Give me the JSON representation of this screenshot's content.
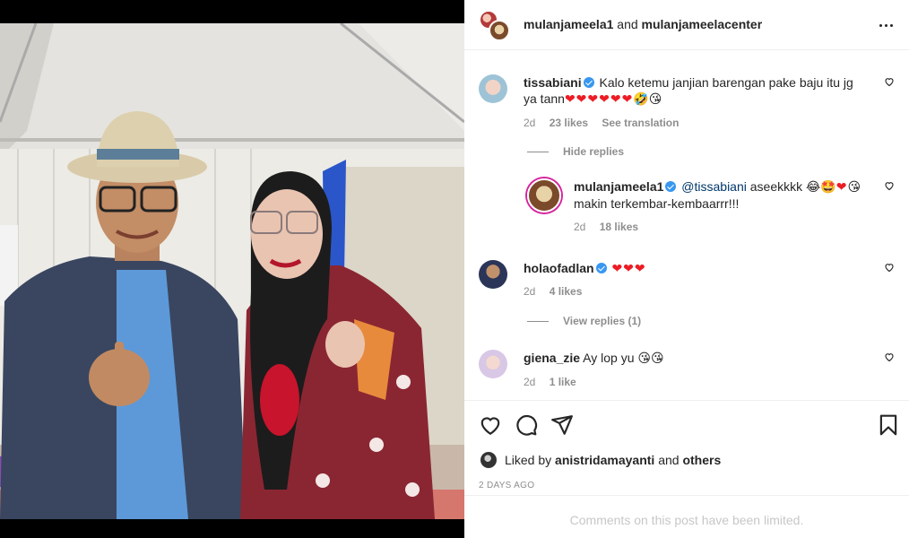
{
  "header": {
    "user1": "mulanjameela1",
    "joiner": "and",
    "user2": "mulanjameelacenter"
  },
  "comments": [
    {
      "username": "tissabiani",
      "text": "Kalo ketemu janjian barengan pake baju itu jg ya tann",
      "hearts": "❤❤❤❤❤❤",
      "emoji": "🤣😘",
      "time": "2d",
      "likes": "23 likes",
      "translate": "See translation"
    },
    {
      "username": "mulanjameela1",
      "mention": "@tissabiani",
      "text": "aseekkkk",
      "emoji_a": "😂🤩",
      "hearts": "❤",
      "emoji_b": "😘",
      "text2": "makin terkembar-kembaarrr!!!",
      "time": "2d",
      "likes": "18 likes"
    },
    {
      "username": "holaofadlan",
      "hearts": "❤❤❤",
      "time": "2d",
      "likes": "4 likes"
    },
    {
      "username": "giena_zie",
      "text": "Ay lop yu",
      "emoji": "😘😘",
      "time": "2d",
      "likes": "1 like"
    }
  ],
  "toggles": {
    "hide_replies": "Hide replies",
    "view_replies": "View replies (1)"
  },
  "likes_line": {
    "prefix": "Liked by",
    "user": "anistridamayanti",
    "and": "and",
    "others": "others"
  },
  "post_date": "2 DAYS AGO",
  "limited_notice": "Comments on this post have been limited.",
  "icons": [
    "heart-icon",
    "comment-icon",
    "share-icon",
    "bookmark-icon",
    "more-icon"
  ]
}
